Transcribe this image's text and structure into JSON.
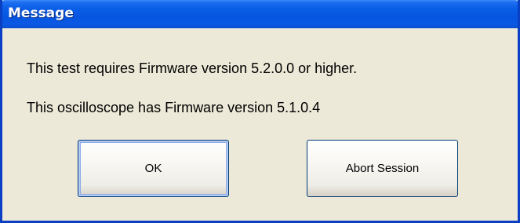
{
  "window": {
    "title": "Message"
  },
  "message": {
    "line1": "This test requires Firmware version 5.2.0.0 or higher.",
    "line2": "This oscilloscope has Firmware version 5.1.0.4"
  },
  "buttons": {
    "ok_label": "OK",
    "abort_label": "Abort Session"
  },
  "colors": {
    "titlebar": "#0a5ee6",
    "frame": "#0a3fc4",
    "client_background": "#ece9d8"
  }
}
